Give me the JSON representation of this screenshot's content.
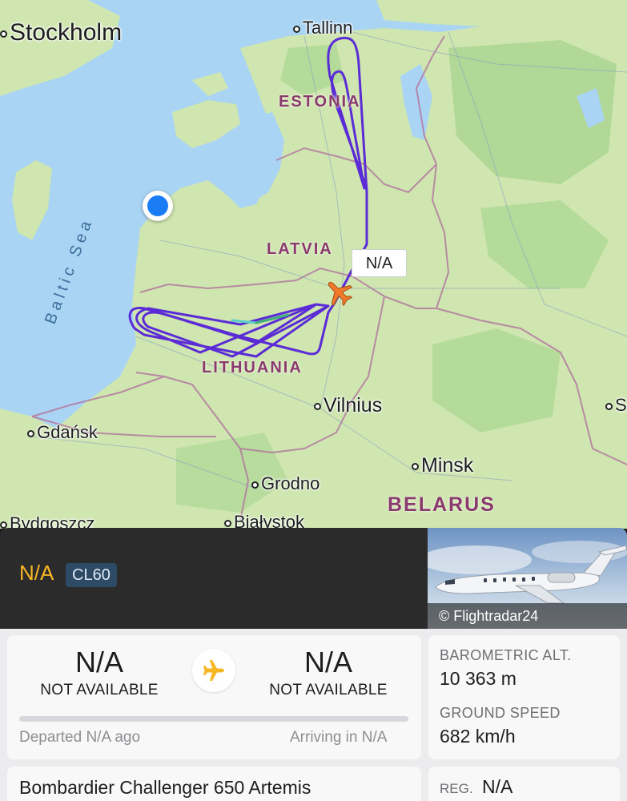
{
  "map": {
    "cities": [
      {
        "name": "Stockholm"
      },
      {
        "name": "Tallinn"
      },
      {
        "name": "Gdańsk"
      },
      {
        "name": "Vilnius"
      },
      {
        "name": "Minsk"
      },
      {
        "name": "Grodno"
      },
      {
        "name": "Bydgoszcz"
      },
      {
        "name": "Białystok"
      },
      {
        "name": "S"
      }
    ],
    "countries": [
      "ESTONIA",
      "LATVIA",
      "LITHUANIA",
      "BELARUS"
    ],
    "sea": "Baltic Sea",
    "callout": "N/A",
    "colors": {
      "water": "#a9d4f3",
      "land": "#cfe6b0",
      "forest": "#a9d591",
      "border": "#b47aa0",
      "track": "#5b2bd6",
      "aircraft": "#f07a2a",
      "location": "#1a7cf4"
    }
  },
  "header": {
    "flight": "N/A",
    "type_code": "CL60",
    "photo_credit": "© Flightradar24"
  },
  "route": {
    "origin_code": "N/A",
    "origin_name": "NOT AVAILABLE",
    "dest_code": "N/A",
    "dest_name": "NOT AVAILABLE",
    "departed": "Departed N/A ago",
    "arriving": "Arriving in N/A",
    "progress": 0
  },
  "stats": {
    "alt_label": "BAROMETRIC ALT.",
    "alt_value": "10 363 m",
    "speed_label": "GROUND SPEED",
    "speed_value": "682 km/h"
  },
  "aircraft": {
    "name": "Bombardier Challenger 650 Artemis",
    "reg_label": "REG.",
    "reg_value": "N/A"
  }
}
